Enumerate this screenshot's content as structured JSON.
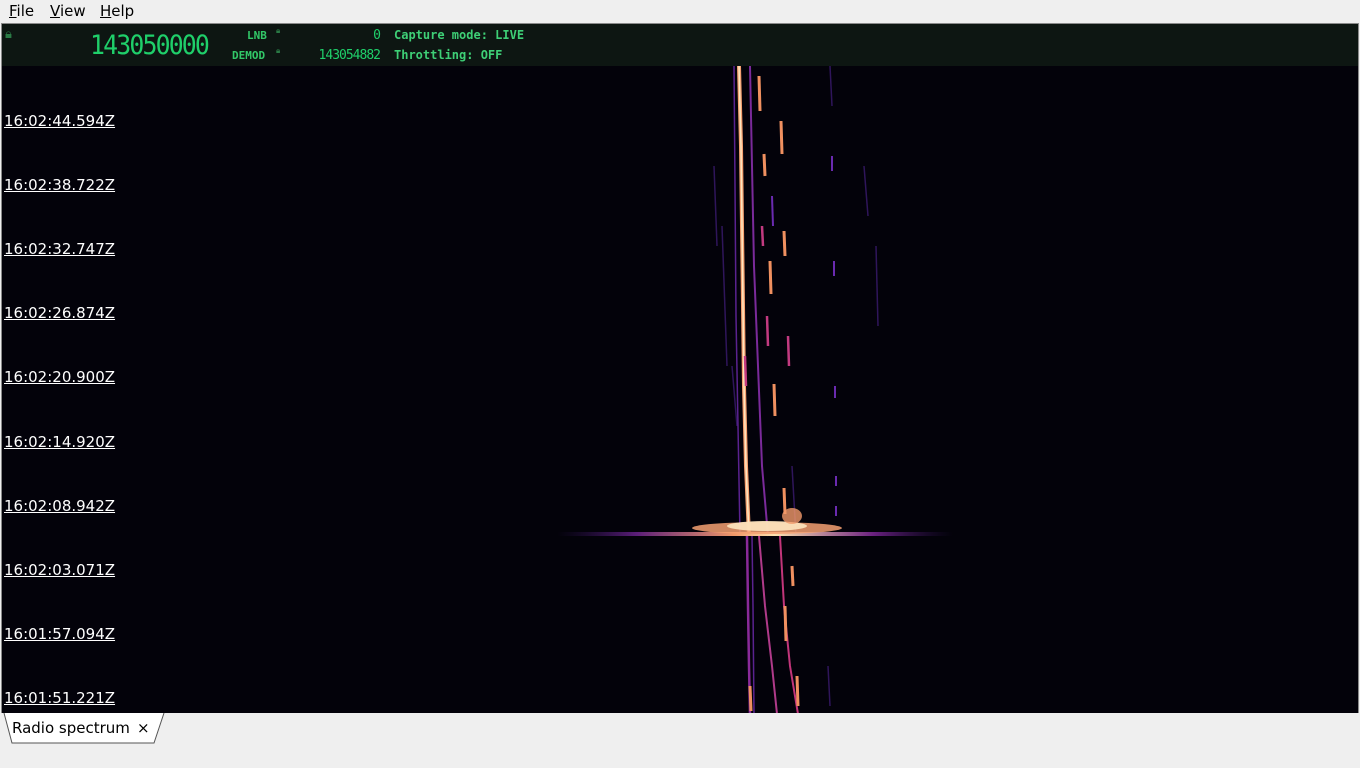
{
  "menu": {
    "file": {
      "mnemonic": "F",
      "rest": "ile"
    },
    "view": {
      "mnemonic": "V",
      "rest": "iew"
    },
    "help": {
      "mnemonic": "H",
      "rest": "elp"
    }
  },
  "freqbar": {
    "center_freq": "143050000",
    "lnb_label": "LNB",
    "lnb_value": "0",
    "demod_label": "DEMOD",
    "demod_value": "143054882",
    "capture_mode": "Capture mode: LIVE",
    "throttling": "Throttling: OFF",
    "lock_icon": "lock-icon"
  },
  "waterfall": {
    "timestamps": [
      "16:02:44.594Z",
      "16:02:38.722Z",
      "16:02:32.747Z",
      "16:02:26.874Z",
      "16:02:20.900Z",
      "16:02:14.920Z",
      "16:02:08.942Z",
      "16:02:03.071Z",
      "16:01:57.094Z",
      "16:01:51.221Z"
    ],
    "colors": {
      "background": "#03020a",
      "low": "#3b1a6e",
      "mid": "#c2357a",
      "high": "#f8b27a",
      "peak": "#fde9c4"
    }
  },
  "tabs": [
    {
      "label": "Radio spectrum",
      "close": "×"
    }
  ]
}
